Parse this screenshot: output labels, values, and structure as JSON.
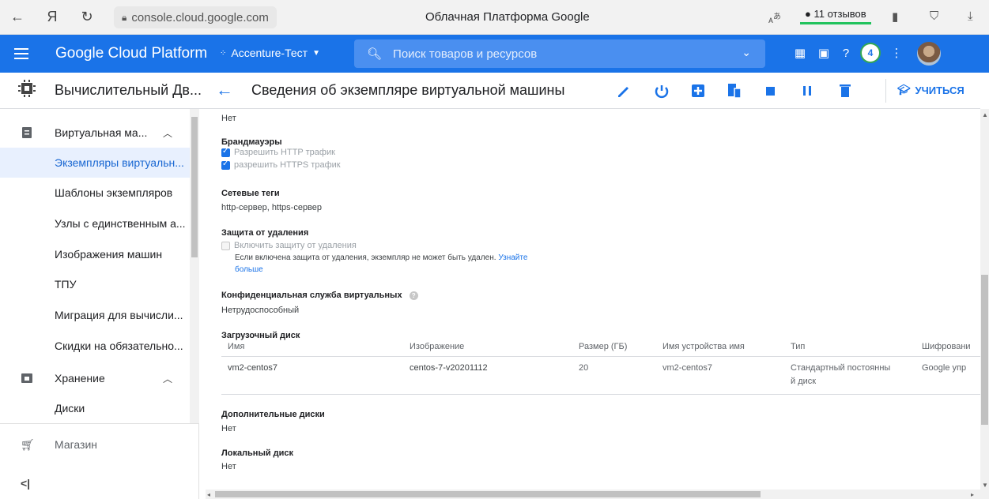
{
  "browser": {
    "url": "console.cloud.google.com",
    "title": "Облачная Платформа Google",
    "reviews": "11 отзывов",
    "translate_icon": "translate-icon"
  },
  "header": {
    "product": "Google Cloud Platform",
    "project": "Accenture-Тест",
    "search_placeholder": "Поиск товаров и ресурсов",
    "notifications": "4",
    "accent": "#1a73e8"
  },
  "titlebar": {
    "section": "Вычислительный Дв...",
    "page_title": "Сведения об экземпляре виртуальной машины",
    "learn": "УЧИТЬСЯ"
  },
  "sidebar": {
    "items": [
      {
        "label": "Виртуальная ма..."
      },
      {
        "label": "Экземпляры виртуальн..."
      },
      {
        "label": "Шаблоны экземпляров"
      },
      {
        "label": "Узлы с единственным а..."
      },
      {
        "label": "Изображения машин"
      },
      {
        "label": "ТПУ"
      },
      {
        "label": "Миграция для вычисли..."
      },
      {
        "label": "Скидки на обязательно..."
      },
      {
        "label": "Хранение"
      },
      {
        "label": "Диски"
      },
      {
        "label": "Магазин"
      }
    ],
    "collapse": "<|"
  },
  "details": {
    "top_value": "Нет",
    "firewalls": {
      "label": "Брандмауэры",
      "http": "Разрешить HTTP трафик",
      "https": "разрешить HTTPS трафик"
    },
    "network_tags": {
      "label": "Сетевые теги",
      "value": "http-сервер, https-сервер"
    },
    "deletion_protection": {
      "label": "Защита от удаления",
      "checkbox": "Включить защиту от удаления",
      "note": "Если включена защита от удаления, экземпляр не может быть удален.",
      "learn_more_1": "Узнайте",
      "learn_more_2": "больше"
    },
    "confidential": {
      "label": "Конфиденциальная служба виртуальных",
      "value": "Нетрудоспособный"
    },
    "boot_disk": {
      "label": "Загрузочный диск",
      "columns": [
        "Имя",
        "Изображение",
        "Размер (ГБ)",
        "Имя устройства имя",
        "Тип",
        "Шифровани"
      ],
      "row": [
        "vm2-centos7",
        "centos-7-v20201112",
        "20",
        "vm2-centos7",
        "Стандартный постоянны",
        "й диск",
        "Google упр"
      ]
    },
    "additional_disks": {
      "label": "Дополнительные диски",
      "value": "Нет"
    },
    "local_disk": {
      "label": "Локальный диск",
      "value": "Нет"
    }
  }
}
